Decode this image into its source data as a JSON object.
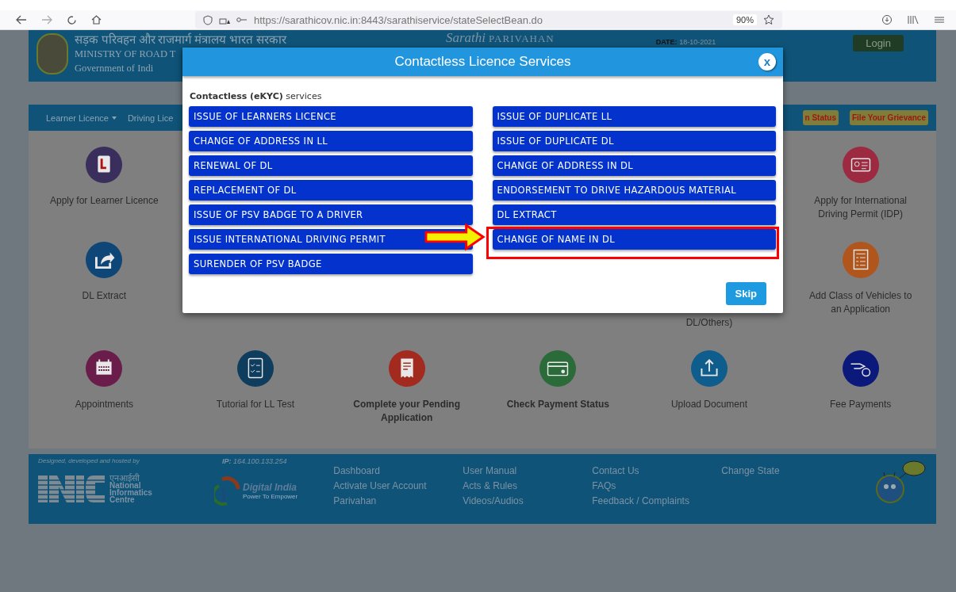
{
  "browser": {
    "url": "https://sarathicov.nic.in:8443/sarathiservice/stateSelectBean.do",
    "zoom": "90%"
  },
  "header": {
    "hindi": "सड़क परिवहन और राजमार्ग मंत्रालय भारत सरकार",
    "ministry": "MINISTRY OF ROAD T",
    "government": "Government of Indi",
    "logo_script": "Sarathi",
    "logo_word": "PARIVAHAN",
    "date_label": "DATE:",
    "date": "18-10-2021",
    "login": "Login"
  },
  "nav": {
    "menus": [
      "Learner Licence",
      "Driving Lice"
    ],
    "status_buttons": [
      "n Status",
      "File Your Grievance"
    ]
  },
  "tile_rows": [
    {
      "tiles": [
        {
          "kind": "clipboard",
          "color": "#3a2f5c",
          "caption": "Apply for Learner Licence",
          "bold": false
        },
        {
          "kind": "idcard",
          "color": "#9c2a40",
          "caption": "Apply for International Driving Permit (IDP)",
          "bold": false
        }
      ]
    },
    {
      "tiles": [
        {
          "kind": "share",
          "color": "#0d4677",
          "caption": "DL Extract",
          "bold": false
        },
        {
          "kind": "covered",
          "caption": "DL/Others)",
          "bold": false
        },
        {
          "kind": "form",
          "color": "#b0561c",
          "caption": "Add Class of Vehicles to an Application",
          "bold": false
        }
      ]
    },
    {
      "tiles": [
        {
          "kind": "calendar",
          "color": "#6a1c4a",
          "caption": "Appointments",
          "bold": false
        },
        {
          "kind": "checklist",
          "color": "#0f3d5e",
          "caption": "Tutorial for LL Test",
          "bold": false
        },
        {
          "kind": "receipt",
          "color": "#a22a1f",
          "caption": "Complete your Pending Application",
          "bold": true
        },
        {
          "kind": "card",
          "color": "#2b6b3a",
          "caption": "Check Payment Status",
          "bold": true
        },
        {
          "kind": "upload",
          "color": "#0f5d8c",
          "caption": "Upload Document",
          "bold": false
        },
        {
          "kind": "coin",
          "color": "#0b1a7a",
          "caption": "Fee Payments",
          "bold": false
        }
      ]
    }
  ],
  "footer": {
    "credit": "Designed, developed and hosted by",
    "nic_hindi": "एनआईसी",
    "nic_name": "National Informatics Centre",
    "ip": "**IP:** 164.100.133.254",
    "di_name": "Digital India",
    "di_tag": "Power To Empower",
    "link_columns": [
      [
        "Dashboard",
        "Activate User Account",
        "Parivahan"
      ],
      [
        "User Manual",
        "Acts & Rules",
        "Videos/Audios"
      ],
      [
        "Contact Us",
        "FAQs",
        "Feedback / Complaints"
      ],
      [
        "Change State"
      ]
    ]
  },
  "modal": {
    "title": "Contactless Licence Services",
    "close": "x",
    "subtitle": "**Contactless (eKYC)** services",
    "left": [
      {
        "label": "ISSUE OF LEARNERS LICENCE",
        "highlighted": false
      },
      {
        "label": "CHANGE OF ADDRESS IN LL",
        "highlighted": false
      },
      {
        "label": "RENEWAL OF DL",
        "highlighted": false
      },
      {
        "label": "REPLACEMENT OF DL",
        "highlighted": false
      },
      {
        "label": "ISSUE OF PSV BADGE TO A DRIVER",
        "highlighted": false
      },
      {
        "label": "ISSUE INTERNATIONAL DRIVING PERMIT",
        "highlighted": false
      },
      {
        "label": "SURENDER OF PSV BADGE",
        "highlighted": false
      }
    ],
    "right": [
      {
        "label": "ISSUE OF DUPLICATE LL",
        "highlighted": false
      },
      {
        "label": "ISSUE OF DUPLICATE DL",
        "highlighted": false
      },
      {
        "label": "CHANGE OF ADDRESS IN DL",
        "highlighted": false
      },
      {
        "label": "ENDORSEMENT TO DRIVE HAZARDOUS MATERIAL",
        "highlighted": false
      },
      {
        "label": "DL EXTRACT",
        "highlighted": false
      },
      {
        "label": "CHANGE OF NAME IN DL",
        "highlighted": true
      }
    ],
    "skip": "Skip"
  }
}
